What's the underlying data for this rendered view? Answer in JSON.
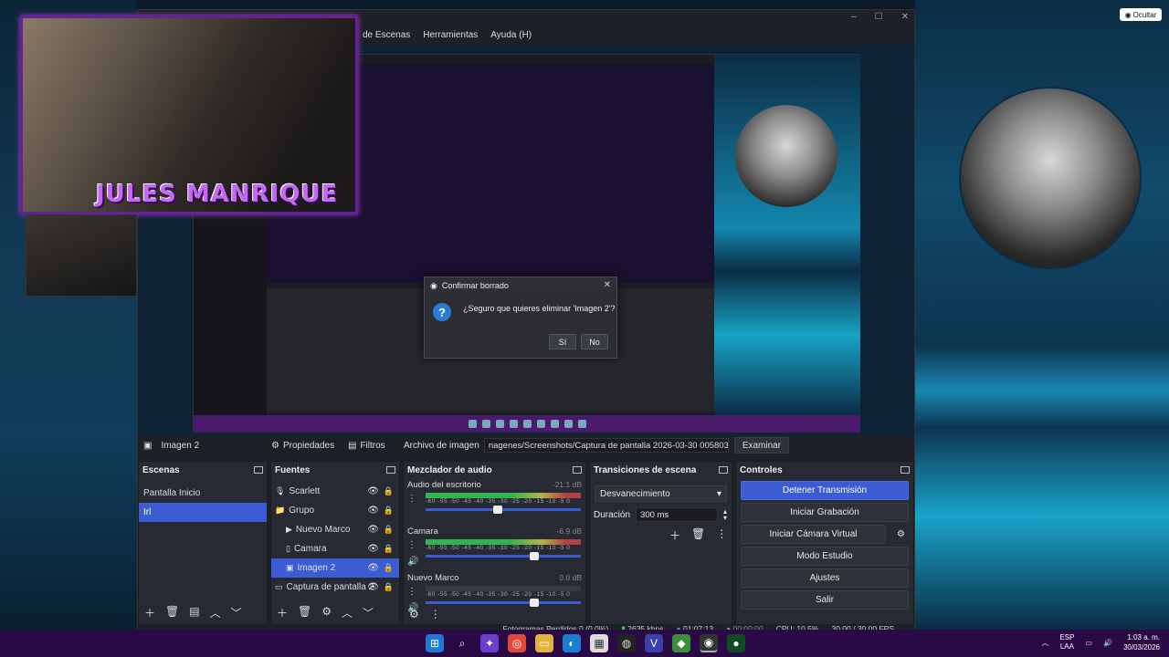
{
  "ocultar_label": "Ocultar",
  "webcam": {
    "overlay_name": "JULES MANRIQUE"
  },
  "menu": [
    "de Escenas",
    "Herramientas",
    "Ayuda (H)"
  ],
  "dialog": {
    "title": "Confirmar borrado",
    "message": "¿Seguro que quieres eliminar 'Imagen 2'?",
    "yes": "Sí",
    "no": "No"
  },
  "source_toolbar": {
    "source_name": "Imagen 2",
    "properties": "Propiedades",
    "filters": "Filtros",
    "file_label": "Archivo de imagen",
    "file_path": "nagenes/Screenshots/Captura de pantalla 2026-03-30 005803.png",
    "browse": "Examinar"
  },
  "scenes": {
    "title": "Escenas",
    "items": [
      "Pantalla Inicio",
      "Irl"
    ],
    "selected": 1
  },
  "sources": {
    "title": "Fuentes",
    "items": [
      {
        "name": "Scarlett",
        "icon": "mic-icon",
        "indent": 0
      },
      {
        "name": "Grupo",
        "icon": "folder-icon",
        "indent": 0
      },
      {
        "name": "Nuevo Marco",
        "icon": "play-icon",
        "indent": 1
      },
      {
        "name": "Camara",
        "icon": "camera-icon",
        "indent": 1
      },
      {
        "name": "Imagen 2",
        "icon": "image-icon",
        "indent": 1
      },
      {
        "name": "Captura de pantalla 2",
        "icon": "monitor-icon",
        "indent": 0
      }
    ],
    "selected": 4
  },
  "mixer": {
    "title": "Mezclador de audio",
    "channels": [
      {
        "name": "Audio del escritorio",
        "db": "-21.1 dB",
        "level": 0.1
      },
      {
        "name": "Camara",
        "db": "-6.9 dB",
        "level": 0.55
      },
      {
        "name": "Nuevo Marco",
        "db": "0.0 dB",
        "level": 0
      }
    ],
    "scale": "-60 -55 -50 -45 -40 -35 -30 -25 -20 -15 -10 -5 0"
  },
  "transitions": {
    "title": "Transiciones de escena",
    "selected": "Desvanecimiento",
    "duration_label": "Duración",
    "duration_value": "300 ms"
  },
  "controls": {
    "title": "Controles",
    "buttons": [
      "Detener Transmisión",
      "Iniciar Grabación",
      "Iniciar Cámara Virtual",
      "Modo Estudio",
      "Ajustes",
      "Salir"
    ]
  },
  "status": {
    "dropped": "Fotogramas Perdidos 0 (0.0%)",
    "bitrate": "2635 kbps",
    "stream_time": "01:07:13",
    "rec_time": "00:00:00",
    "cpu": "CPU: 10.5%",
    "fps": "30.00 / 30.00 FPS"
  },
  "taskbar": {
    "lang_top": "ESP",
    "lang_bottom": "LAA",
    "time": "1:03 a. m.",
    "date": "30/03/2026"
  },
  "colors": {
    "accent": "#3c5cd4",
    "purple": "#6a1f9a",
    "taskbar": "#2a0a45"
  }
}
